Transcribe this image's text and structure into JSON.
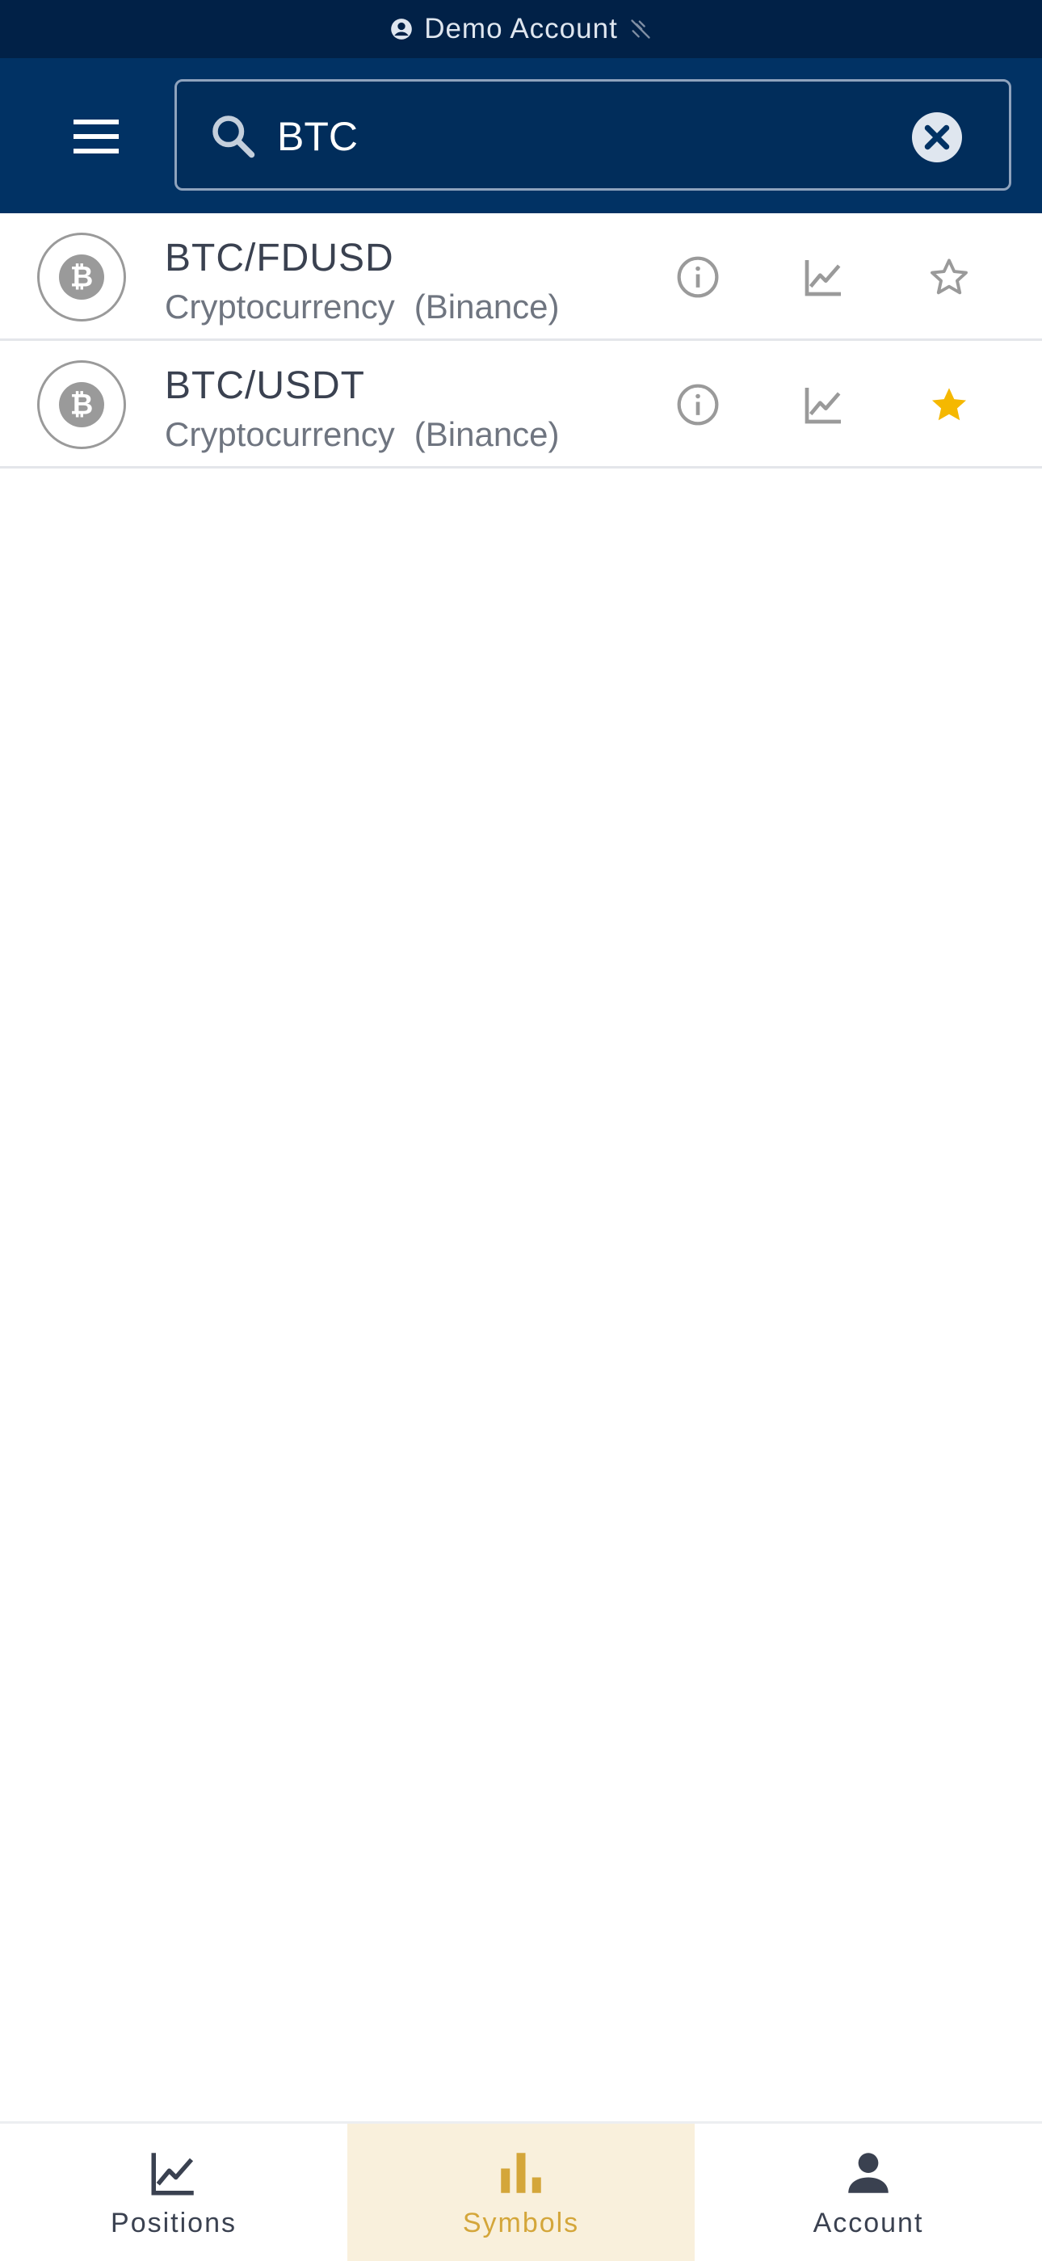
{
  "status_bar": {
    "account_label": "Demo Account"
  },
  "search": {
    "value": "BTC",
    "placeholder": ""
  },
  "symbols": [
    {
      "name": "BTC/FDUSD",
      "category": "Cryptocurrency",
      "exchange": "(Binance)",
      "favorite": false
    },
    {
      "name": "BTC/USDT",
      "category": "Cryptocurrency",
      "exchange": "(Binance)",
      "favorite": true
    }
  ],
  "bottom_nav": {
    "items": [
      {
        "label": "Positions",
        "icon": "line-chart-icon",
        "active": false
      },
      {
        "label": "Symbols",
        "icon": "bar-chart-icon",
        "active": true
      },
      {
        "label": "Account",
        "icon": "person-icon",
        "active": false
      }
    ]
  },
  "colors": {
    "status_bg": "#012147",
    "header_bg": "#013264",
    "accent": "#d4a63a",
    "favorite_star": "#f5b800",
    "active_tab_bg": "#f9f0dc"
  }
}
